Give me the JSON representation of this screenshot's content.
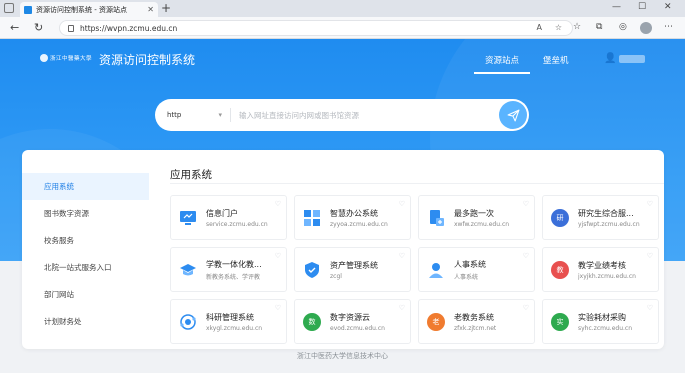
{
  "browser": {
    "tab_title": "资源访问控制系统 - 资源站点",
    "url": "https://wvpn.zcmu.edu.cn"
  },
  "header": {
    "logo_text": "浙江中醫藥大學",
    "site_title": "资源访问控制系统",
    "nav": [
      "资源站点",
      "堡垒机"
    ]
  },
  "search": {
    "protocol": "http",
    "placeholder": "输入网址直接访问内网或图书馆资源"
  },
  "sidebar": {
    "items": [
      "应用系统",
      "图书数字资源",
      "校务服务",
      "北院一站式服务入口",
      "部门网站",
      "计划财务处"
    ]
  },
  "main": {
    "section_title": "应用系统",
    "apps": [
      {
        "name": "信息门户",
        "sub": "service.zcmu.edu.cn",
        "icon": "monitor-icon",
        "color": "#2d8cf0"
      },
      {
        "name": "智慧办公系统",
        "sub": "zyyoa.zcmu.edu.cn",
        "icon": "grid-icon",
        "color": "#2d8cf0"
      },
      {
        "name": "最多跑一次",
        "sub": "xwfw.zcmu.edu.cn",
        "icon": "doc-plus-icon",
        "color": "#2d8cf0"
      },
      {
        "name": "研究生综合服...",
        "sub": "yjsfwpt.zcmu.edu.cn",
        "icon": "yan-icon",
        "color": "#3b6fd9",
        "glyph": "研"
      },
      {
        "name": "学教一体化教...",
        "sub": "新教务系统、学评教",
        "icon": "grad-cap-icon",
        "color": "#2d8cf0"
      },
      {
        "name": "资产管理系统",
        "sub": "zcgl",
        "icon": "shield-icon",
        "color": "#2d8cf0"
      },
      {
        "name": "人事系统",
        "sub": "人事系统",
        "icon": "person-icon",
        "color": "#2d8cf0"
      },
      {
        "name": "教学业绩考核",
        "sub": "jxyjkh.zcmu.edu.cn",
        "icon": "jiao-icon",
        "color": "#e8504f",
        "glyph": "教"
      },
      {
        "name": "科研管理系统",
        "sub": "xkygl.zcmu.edu.cn",
        "icon": "orbit-icon",
        "color": "#2d8cf0"
      },
      {
        "name": "数字资源云",
        "sub": "evod.zcmu.edu.cn",
        "icon": "shu-icon",
        "color": "#2eaa4f",
        "glyph": "数"
      },
      {
        "name": "老教务系统",
        "sub": "zfxk.zjtcm.net",
        "icon": "lao-icon",
        "color": "#f07b2f",
        "glyph": "老"
      },
      {
        "name": "实验耗材采购",
        "sub": "syhc.zcmu.edu.cn",
        "icon": "shi-icon",
        "color": "#2eaa4f",
        "glyph": "实"
      }
    ]
  },
  "footer": {
    "text": "浙江中医药大学信息技术中心"
  }
}
